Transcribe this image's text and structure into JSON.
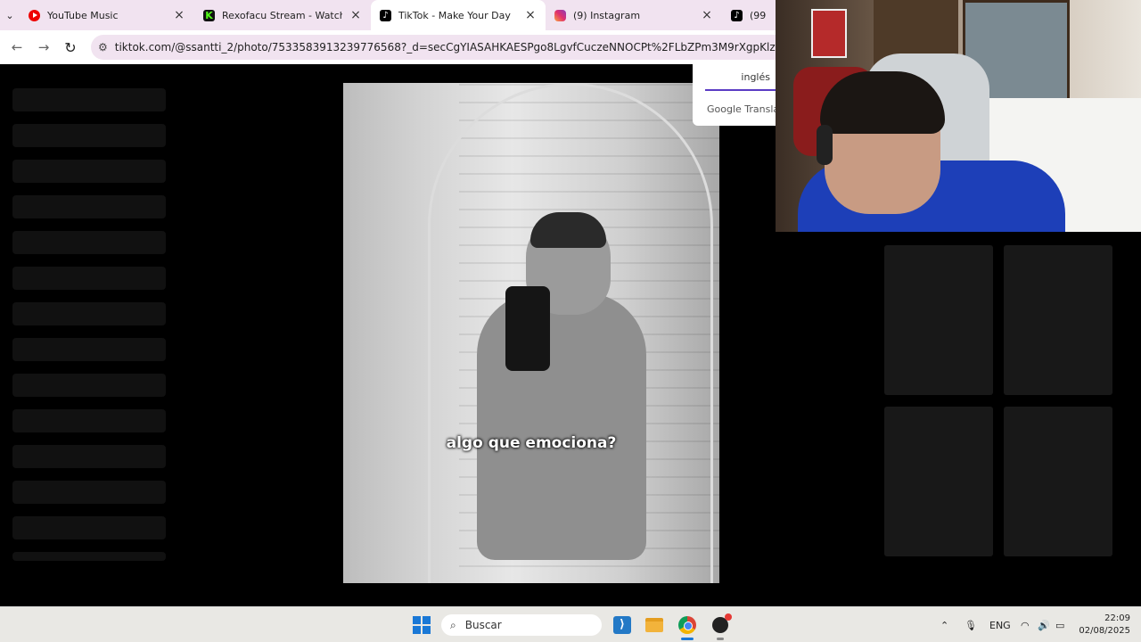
{
  "browser": {
    "tabs": [
      {
        "title": "YouTube Music",
        "favicon": "youtube-music-icon",
        "active": false
      },
      {
        "title": "Rexofacu Stream - Watch Live o",
        "favicon": "kick-icon",
        "active": false
      },
      {
        "title": "TikTok - Make Your Day",
        "favicon": "tiktok-icon",
        "active": true
      },
      {
        "title": "(9) Instagram",
        "favicon": "instagram-icon",
        "active": false
      },
      {
        "title": "(99",
        "favicon": "tiktok-icon",
        "active": false
      }
    ],
    "url": "tiktok.com/@ssantti_2/photo/7533583913239776568?_d=secCgYIASAHKAESPgo8LgvfCuczeNNOCPt%2FLbZPm3M9rXgpKlzPtGl%2B1VfMgJlep"
  },
  "page": {
    "caption": "algo que emociona?",
    "translate": {
      "language": "inglés",
      "brand": "Google Translate"
    }
  },
  "taskbar": {
    "search_placeholder": "Buscar",
    "language": "ENG",
    "time": "22:09",
    "date": "02/08/2025"
  }
}
